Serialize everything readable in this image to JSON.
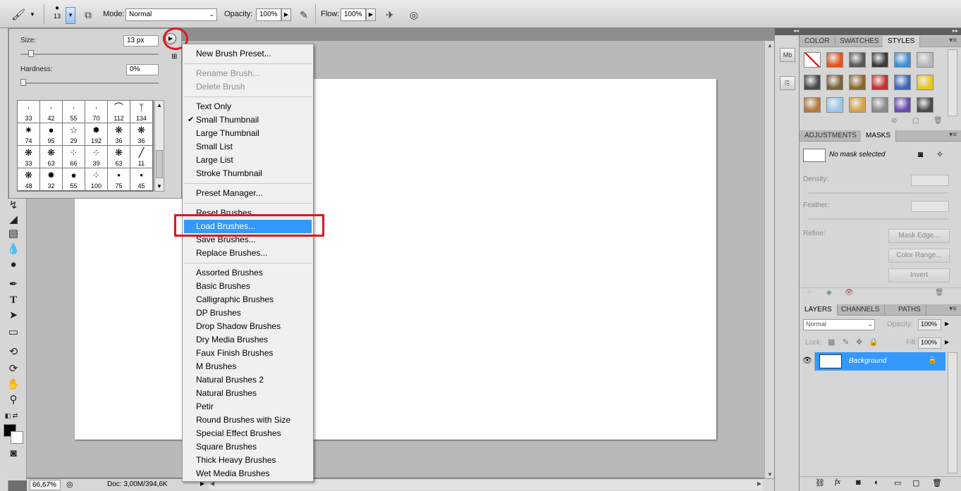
{
  "options_bar": {
    "brush_size": "13",
    "mode_label": "Mode:",
    "mode_value": "Normal",
    "opacity_label": "Opacity:",
    "opacity_value": "100%",
    "flow_label": "Flow:",
    "flow_value": "100%"
  },
  "brush_picker": {
    "size_label": "Size:",
    "size_value": "13 px",
    "hardness_label": "Hardness:",
    "hardness_value": "0%",
    "size_slider_fraction": 0.06,
    "hardness_slider_fraction": 0.0,
    "brushes": [
      {
        "glyph": "·",
        "size": "33"
      },
      {
        "glyph": "·",
        "size": "42"
      },
      {
        "glyph": "·",
        "size": "55"
      },
      {
        "glyph": "·",
        "size": "70"
      },
      {
        "glyph": "⌒",
        "size": "112"
      },
      {
        "glyph": "ᛉ",
        "size": "134"
      },
      {
        "glyph": "✷",
        "size": "74"
      },
      {
        "glyph": "●",
        "size": "95"
      },
      {
        "glyph": "☆",
        "size": "29"
      },
      {
        "glyph": "✹",
        "size": "192"
      },
      {
        "glyph": "❋",
        "size": "36"
      },
      {
        "glyph": "❋",
        "size": "36"
      },
      {
        "glyph": "❋",
        "size": "33"
      },
      {
        "glyph": "❋",
        "size": "63"
      },
      {
        "glyph": "⁘",
        "size": "66"
      },
      {
        "glyph": "⁘",
        "size": "39"
      },
      {
        "glyph": "❋",
        "size": "63"
      },
      {
        "glyph": "╱",
        "size": "11"
      },
      {
        "glyph": "❋",
        "size": "48"
      },
      {
        "glyph": "✸",
        "size": "32"
      },
      {
        "glyph": "●",
        "size": "55"
      },
      {
        "glyph": "⁘",
        "size": "100"
      },
      {
        "glyph": "•",
        "size": "75"
      },
      {
        "glyph": "•",
        "size": "45"
      }
    ]
  },
  "menu": {
    "items": [
      {
        "label": "New Brush Preset...",
        "state": "normal"
      },
      {
        "label": "Rename Brush...",
        "state": "disabled"
      },
      {
        "label": "Delete Brush",
        "state": "disabled"
      },
      {
        "label": "Text Only",
        "state": "normal"
      },
      {
        "label": "Small Thumbnail",
        "state": "checked"
      },
      {
        "label": "Large Thumbnail",
        "state": "normal"
      },
      {
        "label": "Small List",
        "state": "normal"
      },
      {
        "label": "Large List",
        "state": "normal"
      },
      {
        "label": "Stroke Thumbnail",
        "state": "normal"
      },
      {
        "label": "Preset Manager...",
        "state": "normal"
      },
      {
        "label": "Reset Brushes...",
        "state": "normal"
      },
      {
        "label": "Load Brushes...",
        "state": "selected"
      },
      {
        "label": "Save Brushes...",
        "state": "normal"
      },
      {
        "label": "Replace Brushes...",
        "state": "normal"
      },
      {
        "label": "Assorted Brushes",
        "state": "normal"
      },
      {
        "label": "Basic Brushes",
        "state": "normal"
      },
      {
        "label": "Calligraphic Brushes",
        "state": "normal"
      },
      {
        "label": "DP Brushes",
        "state": "normal"
      },
      {
        "label": "Drop Shadow Brushes",
        "state": "normal"
      },
      {
        "label": "Dry Media Brushes",
        "state": "normal"
      },
      {
        "label": "Faux Finish Brushes",
        "state": "normal"
      },
      {
        "label": "M Brushes",
        "state": "normal"
      },
      {
        "label": "Natural Brushes 2",
        "state": "normal"
      },
      {
        "label": "Natural Brushes",
        "state": "normal"
      },
      {
        "label": "Petir",
        "state": "normal"
      },
      {
        "label": "Round Brushes with Size",
        "state": "normal"
      },
      {
        "label": "Special Effect Brushes",
        "state": "normal"
      },
      {
        "label": "Square Brushes",
        "state": "normal"
      },
      {
        "label": "Thick Heavy Brushes",
        "state": "normal"
      },
      {
        "label": "Wet Media Brushes",
        "state": "normal"
      }
    ]
  },
  "status_bar": {
    "zoom": "66,67%",
    "doc_info": "Doc: 3,00M/394,6K"
  },
  "color_panel": {
    "tabs": [
      "COLOR",
      "SWATCHES",
      "STYLES"
    ],
    "active_tab": "STYLES",
    "style_colors": [
      "#ffffff",
      "#e8531a",
      "#5a5a5a",
      "#3a3a3a",
      "#3f8fd8",
      "#b8b8b8",
      "#4a4a4a",
      "#7a6236",
      "#8a6a2a",
      "#c83030",
      "#3a6ab8",
      "#e8c820",
      "#b87838",
      "#9ac8f0",
      "#d8a048",
      "#8a8a8a",
      "#6a4ab0",
      "#4a4a4a"
    ]
  },
  "masks_panel": {
    "tabs": [
      "ADJUSTMENTS",
      "MASKS"
    ],
    "active_tab": "MASKS",
    "no_mask_text": "No mask selected",
    "density_label": "Density:",
    "feather_label": "Feather:",
    "refine_label": "Refine:",
    "mask_edge_label": "Mask Edge...",
    "color_range_label": "Color Range...",
    "invert_label": "Invert"
  },
  "layers_panel": {
    "tabs": [
      "LAYERS",
      "CHANNELS",
      "PATHS"
    ],
    "active_tab": "LAYERS",
    "blend_mode": "Normal",
    "opacity_label": "Opacity:",
    "opacity_value": "100%",
    "lock_label": "Lock:",
    "fill_label": "Fill:",
    "fill_value": "100%",
    "layer_name": "Background"
  },
  "dock": {
    "mini_bridge_label": "Mb"
  }
}
